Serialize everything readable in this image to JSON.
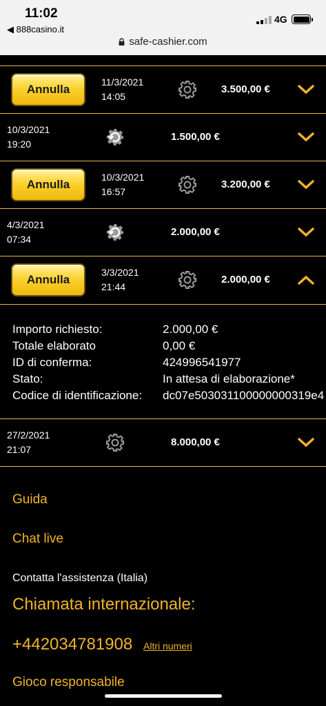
{
  "status_bar": {
    "time": "11:02",
    "back_label": "◀ 888casino.it",
    "network": "4G"
  },
  "browser": {
    "url": "safe-cashier.com"
  },
  "transactions": [
    {
      "has_cancel": true,
      "cancel_label": "Annulla",
      "date": "11/3/2021",
      "time": "14:05",
      "icon": "gear-icon",
      "amount": "3.500,00 €",
      "expanded": false
    },
    {
      "has_cancel": false,
      "cancel_label": "",
      "date": "10/3/2021",
      "time": "19:20",
      "icon": "reverse-icon",
      "amount": "1.500,00 €",
      "expanded": false
    },
    {
      "has_cancel": true,
      "cancel_label": "Annulla",
      "date": "10/3/2021",
      "time": "16:57",
      "icon": "gear-icon",
      "amount": "3.200,00 €",
      "expanded": false
    },
    {
      "has_cancel": false,
      "cancel_label": "",
      "date": "4/3/2021",
      "time": "07:34",
      "icon": "reverse-icon",
      "amount": "2.000,00 €",
      "expanded": false
    },
    {
      "has_cancel": true,
      "cancel_label": "Annulla",
      "date": "3/3/2021",
      "time": "21:44",
      "icon": "gear-icon",
      "amount": "2.000,00 €",
      "expanded": true
    },
    {
      "has_cancel": false,
      "cancel_label": "",
      "date": "27/2/2021",
      "time": "21:07",
      "icon": "gear-icon",
      "amount": "8.000,00 €",
      "expanded": false
    }
  ],
  "details": {
    "rows": [
      {
        "label": "Importo richiesto:",
        "value": "2.000,00 €"
      },
      {
        "label": "Totale elaborato",
        "value": "0,00 €"
      },
      {
        "label": "ID di conferma:",
        "value": "424996541977"
      },
      {
        "label": "Stato:",
        "value": "In attesa di elaborazione*"
      },
      {
        "label": "Codice di identificazione:",
        "value": "dc07e5030311000000003​19e4"
      }
    ]
  },
  "footer": {
    "guida": "Guida",
    "chat_live": "Chat live",
    "contact": "Contatta l'assistenza (Italia)",
    "international_call": "Chiamata internazionale:",
    "phone": "+442034781908",
    "other_numbers": "Altri numeri",
    "responsible_gaming": "Gioco responsabile"
  },
  "colors": {
    "accent": "#f0b429",
    "divider": "#e8b949",
    "button": "#f9cf2a"
  }
}
